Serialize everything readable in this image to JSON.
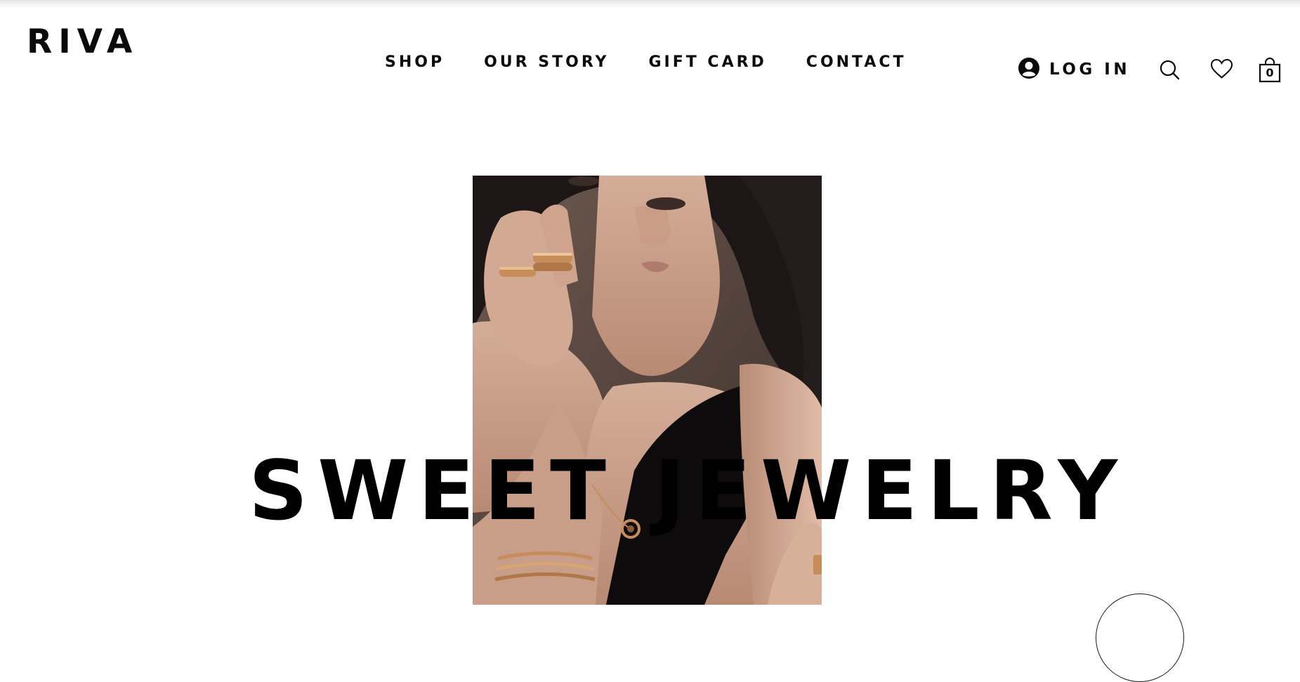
{
  "header": {
    "logo": "RIVA",
    "nav": [
      "SHOP",
      "OUR STORY",
      "GIFT CARD",
      "CONTACT"
    ],
    "login_label": "LOG IN",
    "cart_count": "0",
    "icons": {
      "account": "account-icon",
      "search": "search-icon",
      "wishlist": "heart-icon",
      "cart": "shopping-bag-icon"
    }
  },
  "hero": {
    "title": "SWEET JEWELRY",
    "image": "woman-with-gold-rings-and-bracelets"
  },
  "colors": {
    "text": "#0a0a0a",
    "background": "#ffffff",
    "skin": "#c9a08c",
    "hair": "#1c1716",
    "gold": "#c68d5b"
  }
}
